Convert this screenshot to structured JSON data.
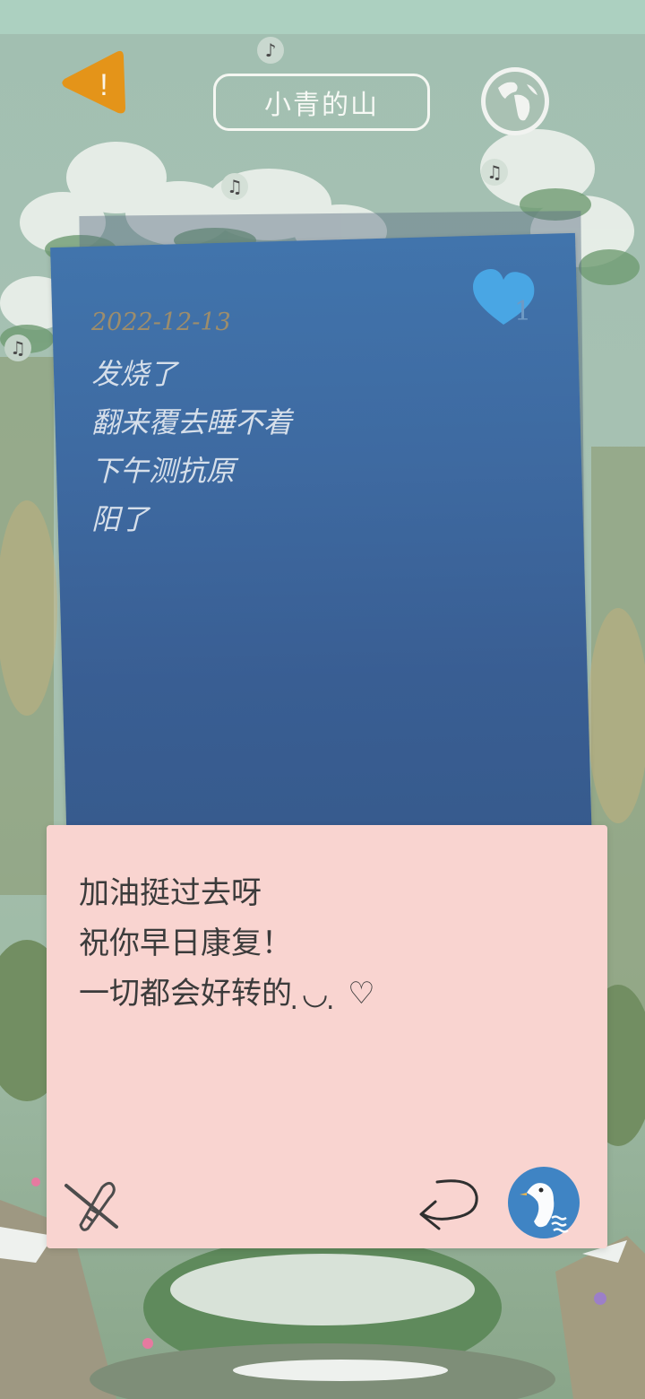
{
  "header": {
    "title": "小青的山",
    "alert_icon_glyph": "!",
    "alert_color": "#e49419",
    "globe_icon": "globe-icon"
  },
  "music_notes": [
    "♪",
    "♫",
    "♫",
    "♫"
  ],
  "letter": {
    "date": "2022-12-13",
    "lines": [
      "发烧了",
      "翻来覆去睡不着",
      "下午测抗原",
      "阳了"
    ],
    "likes": "1",
    "card_color": "#3e6aa1",
    "heart_color": "#49a6e4"
  },
  "reply": {
    "lines": [
      "加油挺过去呀",
      "祝你早日康复！",
      "一切都会好转的 ̣◡ ̣ ♡"
    ],
    "card_color": "#f9d4d0",
    "avatar_color": "#3f84c4"
  }
}
